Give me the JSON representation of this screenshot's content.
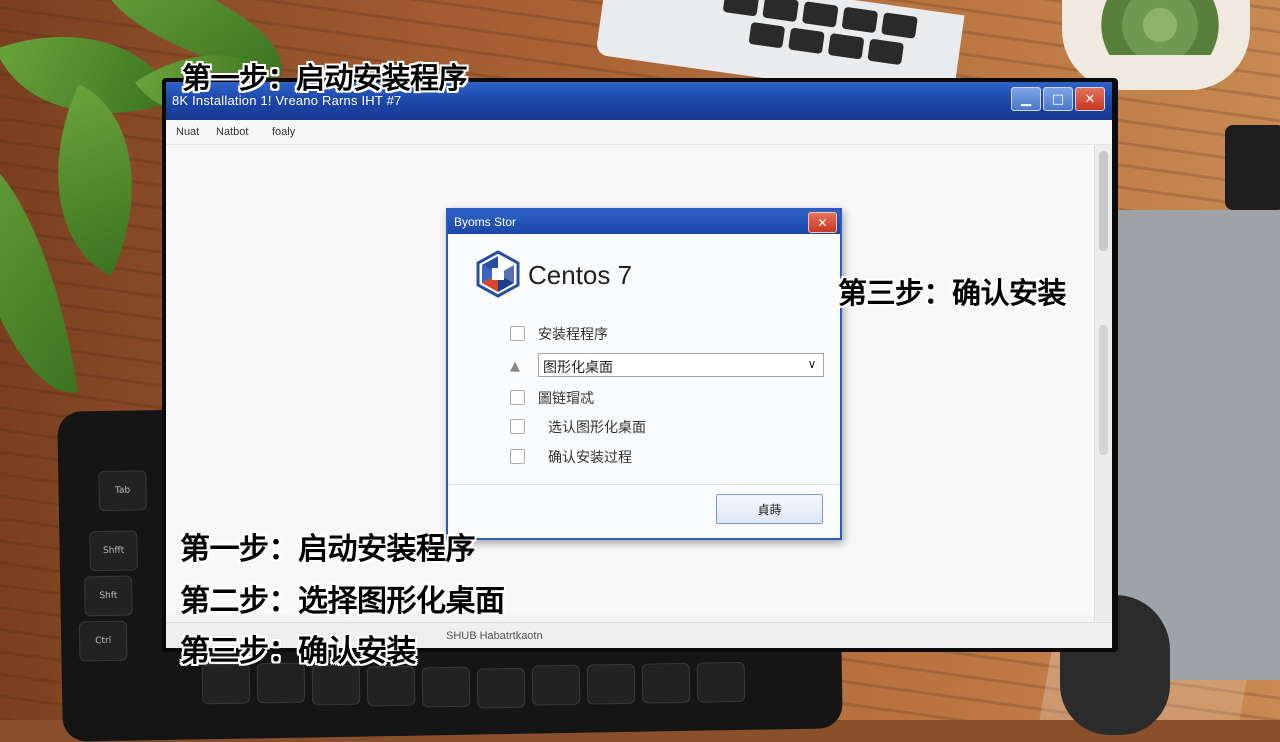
{
  "window": {
    "title": "8K Installation 1! Vreano Rarns IHT #7",
    "menu": [
      "Nuat",
      "Natbot",
      "foaly"
    ],
    "controls": {
      "minimize": "▁",
      "maximize": "□",
      "close": "✕"
    },
    "status_text": "SHUB Habatrtkaotn"
  },
  "dialog": {
    "title": "Byoms Stor",
    "close": "✕",
    "brand": "Centos 7",
    "options": [
      {
        "label": "安装程程序"
      },
      {
        "label": "圖链瑁忒"
      },
      {
        "label": "选认图形化桌面"
      },
      {
        "label": "确认安装过程"
      }
    ],
    "select": {
      "value": "图形化桌面",
      "arrow": "∨"
    },
    "confirm_button": "貞蒔"
  },
  "captions": {
    "top": "第一步：启动安装程序",
    "right": "第三步：确认安装",
    "step1": "第一步：启动安装程序",
    "step2": "第二步：选择图形化桌面",
    "step3": "第三步：确认安装"
  },
  "keyboard_labels": [
    "Tab",
    "Shfft",
    "Shft",
    "Ctrl"
  ]
}
